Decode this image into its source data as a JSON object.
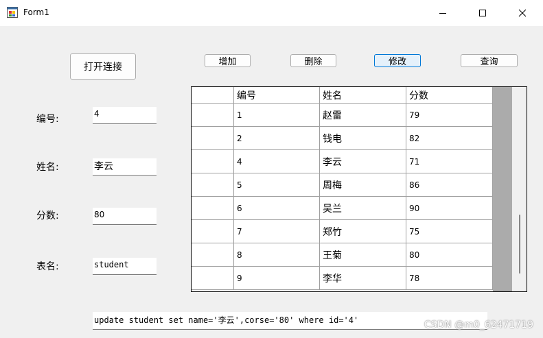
{
  "window": {
    "title": "Form1",
    "minimize_icon": "minimize-icon",
    "maximize_icon": "maximize-icon",
    "close_icon": "close-icon"
  },
  "toolbar": {
    "open_connection": "打开连接",
    "add": "增加",
    "delete": "删除",
    "modify": "修改",
    "query": "查询"
  },
  "form": {
    "id_label": "编号:",
    "id_value": "4",
    "name_label": "姓名:",
    "name_value": "李云",
    "score_label": "分数:",
    "score_value": "80",
    "table_label": "表名:",
    "table_value": "student"
  },
  "grid": {
    "columns": [
      "编号",
      "姓名",
      "分数"
    ],
    "rows": [
      [
        "1",
        "赵雷",
        "79"
      ],
      [
        "2",
        "钱电",
        "82"
      ],
      [
        "4",
        "李云",
        "71"
      ],
      [
        "5",
        "周梅",
        "86"
      ],
      [
        "6",
        "吴兰",
        "90"
      ],
      [
        "7",
        "郑竹",
        "75"
      ],
      [
        "8",
        "王菊",
        "80"
      ],
      [
        "9",
        "李华",
        "78"
      ]
    ]
  },
  "sql_text": "update student set name='李云',corse='80' where id='4'",
  "watermark": "CSDN @m0_62471719"
}
